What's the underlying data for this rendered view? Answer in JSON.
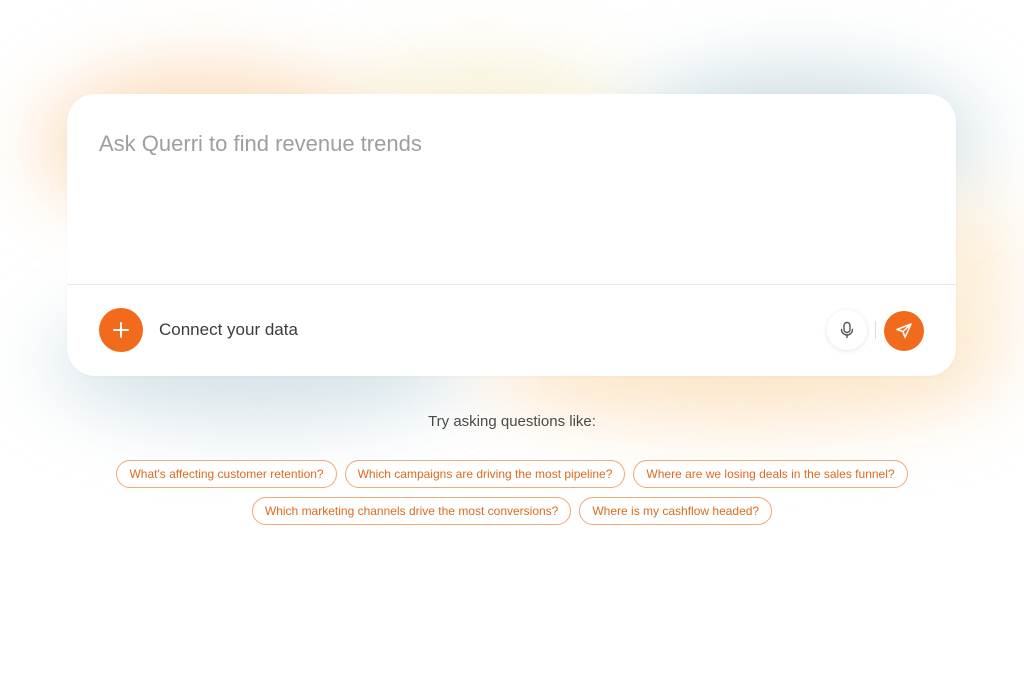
{
  "composer": {
    "placeholder": "Ask Querri to find revenue trends",
    "connect_label": "Connect your data",
    "plus_icon": "plus-icon",
    "mic_icon": "microphone-icon",
    "send_icon": "send-icon"
  },
  "suggestions": {
    "heading": "Try asking questions like:",
    "row1": [
      "What's affecting customer retention?",
      "Which campaigns are driving the most pipeline?",
      "Where are we losing deals in the sales funnel?"
    ],
    "row2": [
      "Which marketing channels drive the most conversions?",
      "Where is my cashflow headed?"
    ]
  },
  "colors": {
    "accent": "#f26a1b",
    "chip_border": "#f0a878",
    "chip_text": "#dd6a20"
  }
}
